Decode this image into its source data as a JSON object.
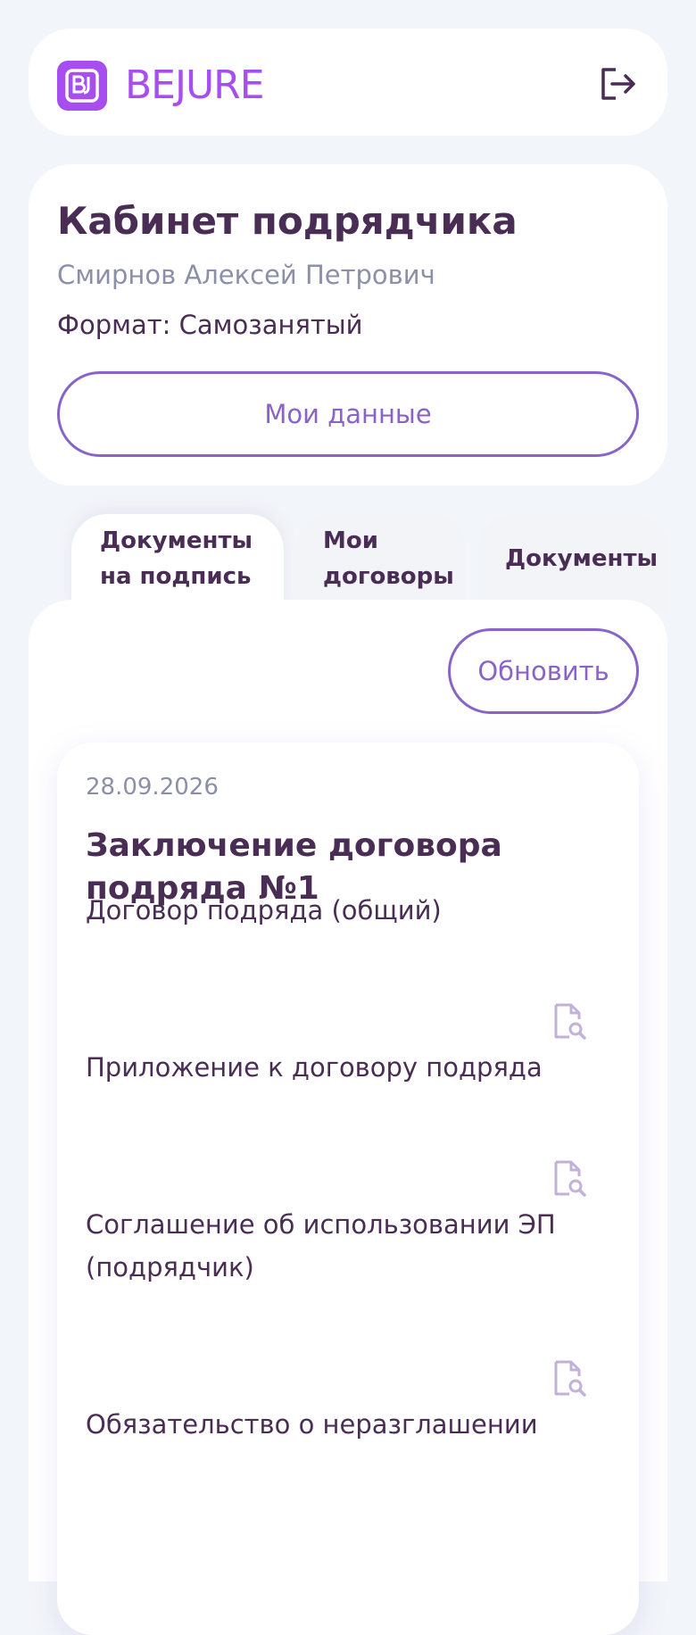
{
  "header": {
    "logo_text": "BEJURE",
    "logo_mark_icon": "bj-logo-icon",
    "logout_icon": "logout-icon"
  },
  "profile": {
    "title": "Кабинет подрядчика",
    "name": "Смирнов Алексей Петрович",
    "format": "Формат: Самозанятый",
    "my_data_label": "Мои данные"
  },
  "tabs": [
    {
      "line1": "Документы",
      "line2": "на подпись",
      "active": true
    },
    {
      "line1": "Мои",
      "line2": "договоры",
      "active": false
    },
    {
      "line1": "Документы",
      "active": false
    }
  ],
  "content": {
    "refresh_label": "Обновить",
    "card": {
      "date": "28.09.2026",
      "title": "Заключение договора подряда №1",
      "documents": [
        {
          "label": "Договор подряда (общий)",
          "icon": "document-search-icon"
        },
        {
          "label": "Приложение к договору подряда",
          "icon": "document-search-icon"
        },
        {
          "label": "Соглашение об использовании ЭП (подрядчик)",
          "icon": "document-search-icon"
        },
        {
          "label": "Обязательство о неразглашении"
        }
      ]
    }
  },
  "colors": {
    "brand": "#a64ef0",
    "accent": "#8a63c9",
    "text": "#4a2d55",
    "muted": "#8b8fa8",
    "icon": "#c2b2da",
    "background": "#f2f5f9"
  }
}
